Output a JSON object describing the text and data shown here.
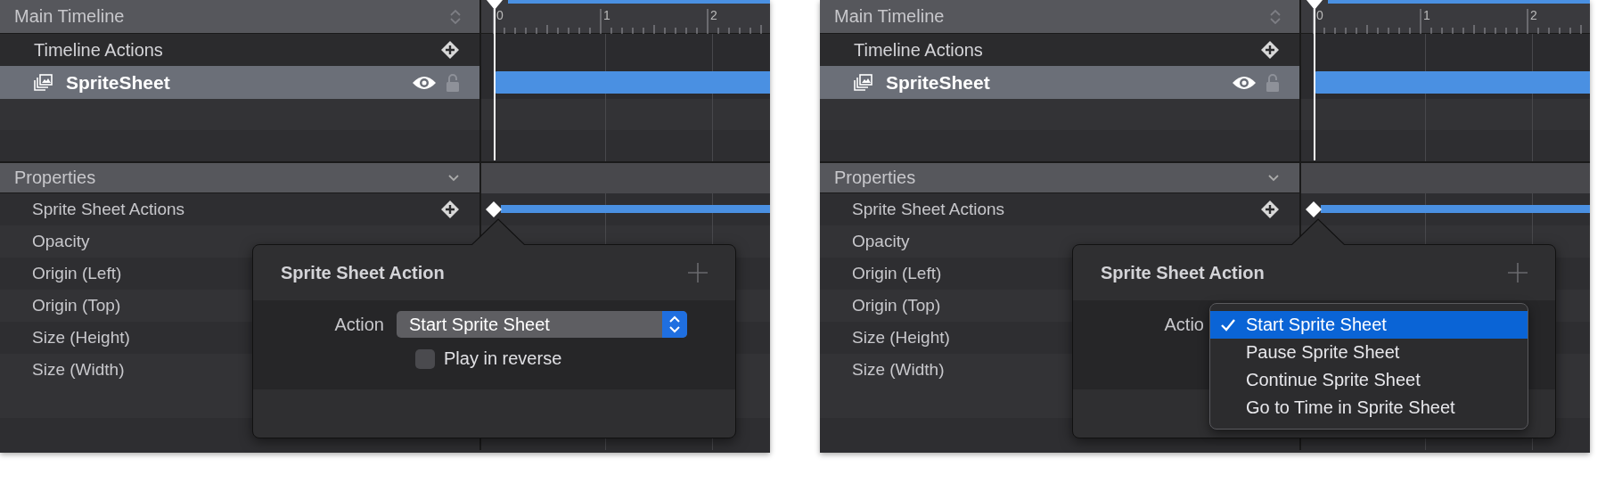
{
  "panels": [
    {
      "timeline": {
        "title": "Main Timeline",
        "ruler_labels": [
          "0",
          "1",
          "2"
        ]
      },
      "layers": [
        {
          "kind": "actions",
          "name": "Timeline Actions",
          "selected": false
        },
        {
          "kind": "layer",
          "name": "SpriteSheet",
          "selected": true
        }
      ],
      "properties": {
        "title": "Properties",
        "expanded": true,
        "rows": [
          {
            "label": "Sprite Sheet Actions",
            "keyframe": true
          },
          {
            "label": "Opacity",
            "keyframe": false
          },
          {
            "label": "Origin (Left)",
            "keyframe": false
          },
          {
            "label": "Origin (Top)",
            "keyframe": false
          },
          {
            "label": "Size (Height)",
            "keyframe": false
          },
          {
            "label": "Size (Width)",
            "keyframe": false
          }
        ]
      },
      "popover": {
        "title": "Sprite Sheet Action",
        "action_label": "Action",
        "action_value": "Start Sprite Sheet",
        "reverse": {
          "label": "Play in reverse",
          "checked": false
        }
      }
    },
    {
      "timeline": {
        "title": "Main Timeline",
        "ruler_labels": [
          "0",
          "1",
          "2"
        ]
      },
      "layers": [
        {
          "kind": "actions",
          "name": "Timeline Actions",
          "selected": false
        },
        {
          "kind": "layer",
          "name": "SpriteSheet",
          "selected": true
        }
      ],
      "properties": {
        "title": "Properties",
        "expanded": true,
        "rows": [
          {
            "label": "Sprite Sheet Actions",
            "keyframe": true
          },
          {
            "label": "Opacity",
            "keyframe": false
          },
          {
            "label": "Origin (Left)",
            "keyframe": false
          },
          {
            "label": "Origin (Top)",
            "keyframe": false
          },
          {
            "label": "Size (Height)",
            "keyframe": false
          },
          {
            "label": "Size (Width)",
            "keyframe": false
          }
        ]
      },
      "popover": {
        "title": "Sprite Sheet Action",
        "action_label": "Actio",
        "menu": [
          {
            "label": "Start Sprite Sheet",
            "selected": true
          },
          {
            "label": "Pause Sprite Sheet",
            "selected": false
          },
          {
            "label": "Continue Sprite Sheet",
            "selected": false
          },
          {
            "label": "Go to Time in Sprite Sheet",
            "selected": false
          }
        ]
      }
    }
  ]
}
